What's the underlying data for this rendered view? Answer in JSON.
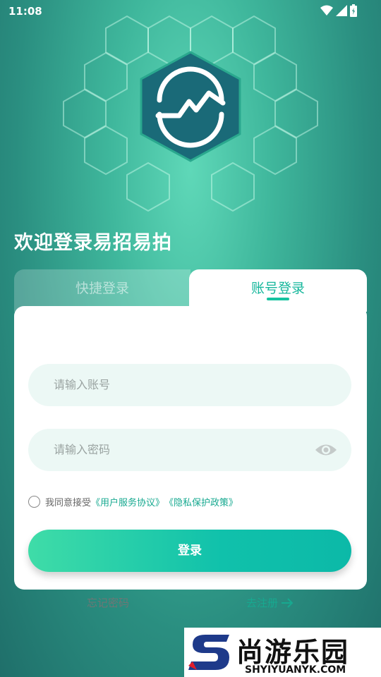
{
  "status_bar": {
    "time": "11:08"
  },
  "welcome_title": "欢迎登录易招易拍",
  "tabs": {
    "quick_login": "快捷登录",
    "account_login": "账号登录"
  },
  "form": {
    "account_placeholder": "请输入账号",
    "password_placeholder": "请输入密码",
    "agreement_prefix": "我同意接受",
    "user_agreement": "《用户服务协议》",
    "privacy_policy": "《隐私保护政策》",
    "login_button": "登录",
    "forgot_password": "忘记密码",
    "register": "去注册"
  },
  "watermark": {
    "title": "尚游乐园",
    "subtitle": "SHYIYUANYK.COM"
  },
  "colors": {
    "accent": "#16b79c",
    "button_start": "#3fdca8",
    "button_end": "#0cb9a8"
  }
}
